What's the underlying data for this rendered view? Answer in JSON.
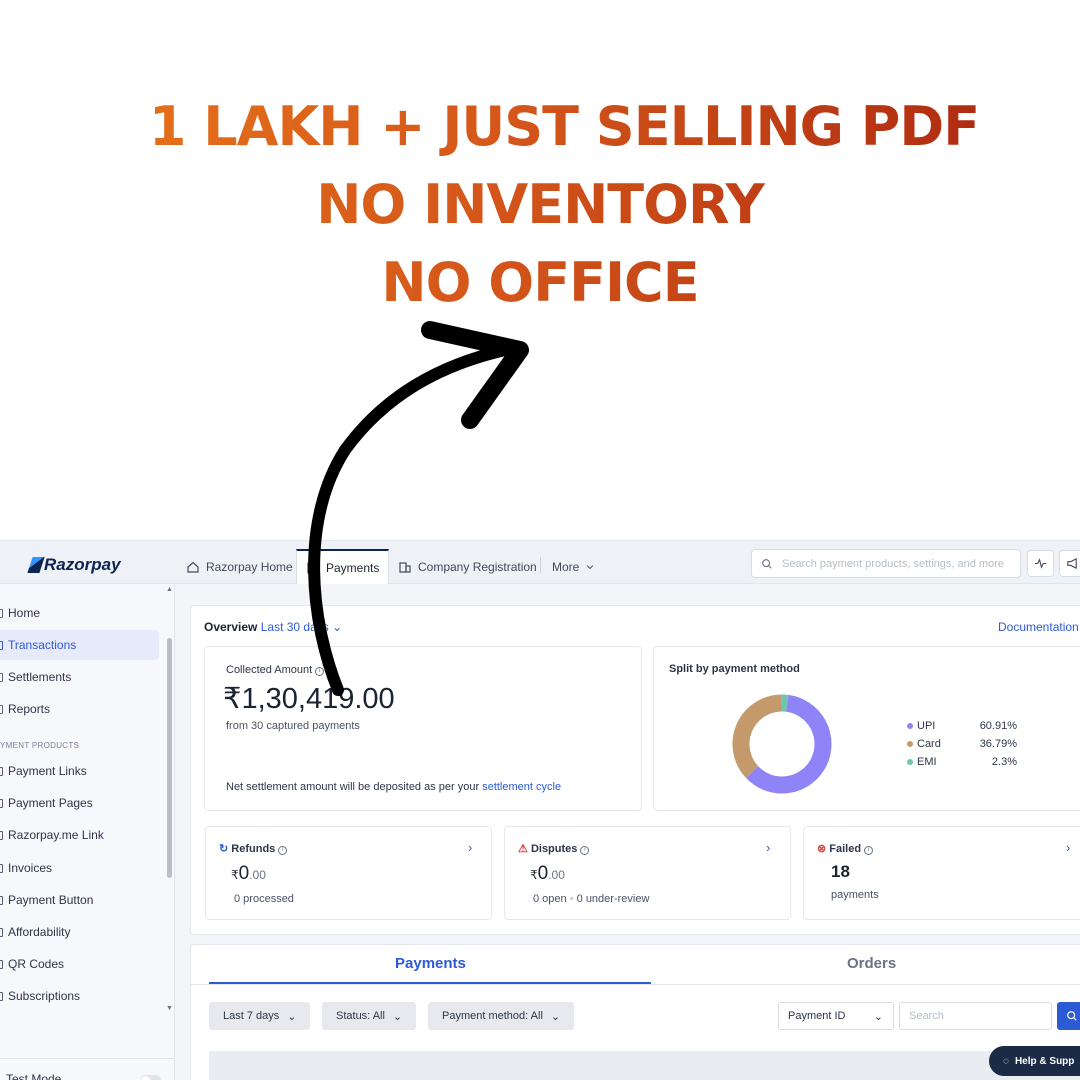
{
  "headline": {
    "line1": "1 LAKH + JUST SELLING PDF",
    "line2": "NO INVENTORY",
    "line3": "NO OFFICE"
  },
  "colors": {
    "accent": "#2d5bd6",
    "navy": "#0c2451",
    "upi": "#8f84f7",
    "card": "#c49a6c",
    "emi": "#6ec6b0",
    "headline_start": "#e8751a",
    "headline_end": "#a8230f"
  },
  "topbar": {
    "logo": "Razorpay",
    "tabs": [
      {
        "label": "Razorpay Home",
        "icon": "home-icon"
      },
      {
        "label": "Payments",
        "icon": "payments-icon"
      },
      {
        "label": "Company Registration",
        "icon": "building-icon"
      },
      {
        "label": "More",
        "icon": "chevron-down-icon"
      }
    ],
    "search_placeholder": "Search payment products, settings, and more"
  },
  "sidebar": {
    "items": [
      {
        "label": "Home"
      },
      {
        "label": "Transactions"
      },
      {
        "label": "Settlements"
      },
      {
        "label": "Reports"
      }
    ],
    "section": "YMENT PRODUCTS",
    "products": [
      {
        "label": "Payment Links"
      },
      {
        "label": "Payment Pages"
      },
      {
        "label": "Razorpay.me Link"
      },
      {
        "label": "Invoices"
      },
      {
        "label": "Payment Button"
      },
      {
        "label": "Affordability"
      },
      {
        "label": "QR Codes"
      },
      {
        "label": "Subscriptions"
      }
    ],
    "test_mode": "Test Mode"
  },
  "overview": {
    "title": "Overview",
    "range": "Last 30 days",
    "doc_link": "Documentation",
    "collected_label": "Collected Amount",
    "collected_value": "₹1,30,419.00",
    "collected_sub": "from 30 captured payments",
    "settlement_note": "Net settlement amount will be deposited as per your",
    "settlement_link": "settlement cycle",
    "split_title": "Split by payment method",
    "split": [
      {
        "name": "UPI",
        "pct": "60.91%",
        "value": 60.91
      },
      {
        "name": "Card",
        "pct": "36.79%",
        "value": 36.79
      },
      {
        "name": "EMI",
        "pct": "2.3%",
        "value": 2.3
      }
    ],
    "refunds": {
      "label": "Refunds",
      "currency": "₹",
      "main": "0",
      "decimals": ".00",
      "sub": "0 processed"
    },
    "disputes": {
      "label": "Disputes",
      "currency": "₹",
      "main": "0",
      "decimals": ".00",
      "sub_open": "0 open",
      "sub_review": "0 under-review"
    },
    "failed": {
      "label": "Failed",
      "value": "18",
      "sub": "payments"
    }
  },
  "list": {
    "tabs": [
      "Payments",
      "Orders"
    ],
    "filters": [
      "Last 7 days",
      "Status: All",
      "Payment method: All"
    ],
    "id_select": "Payment ID",
    "search_placeholder": "Search",
    "help": "Help & Supp"
  }
}
